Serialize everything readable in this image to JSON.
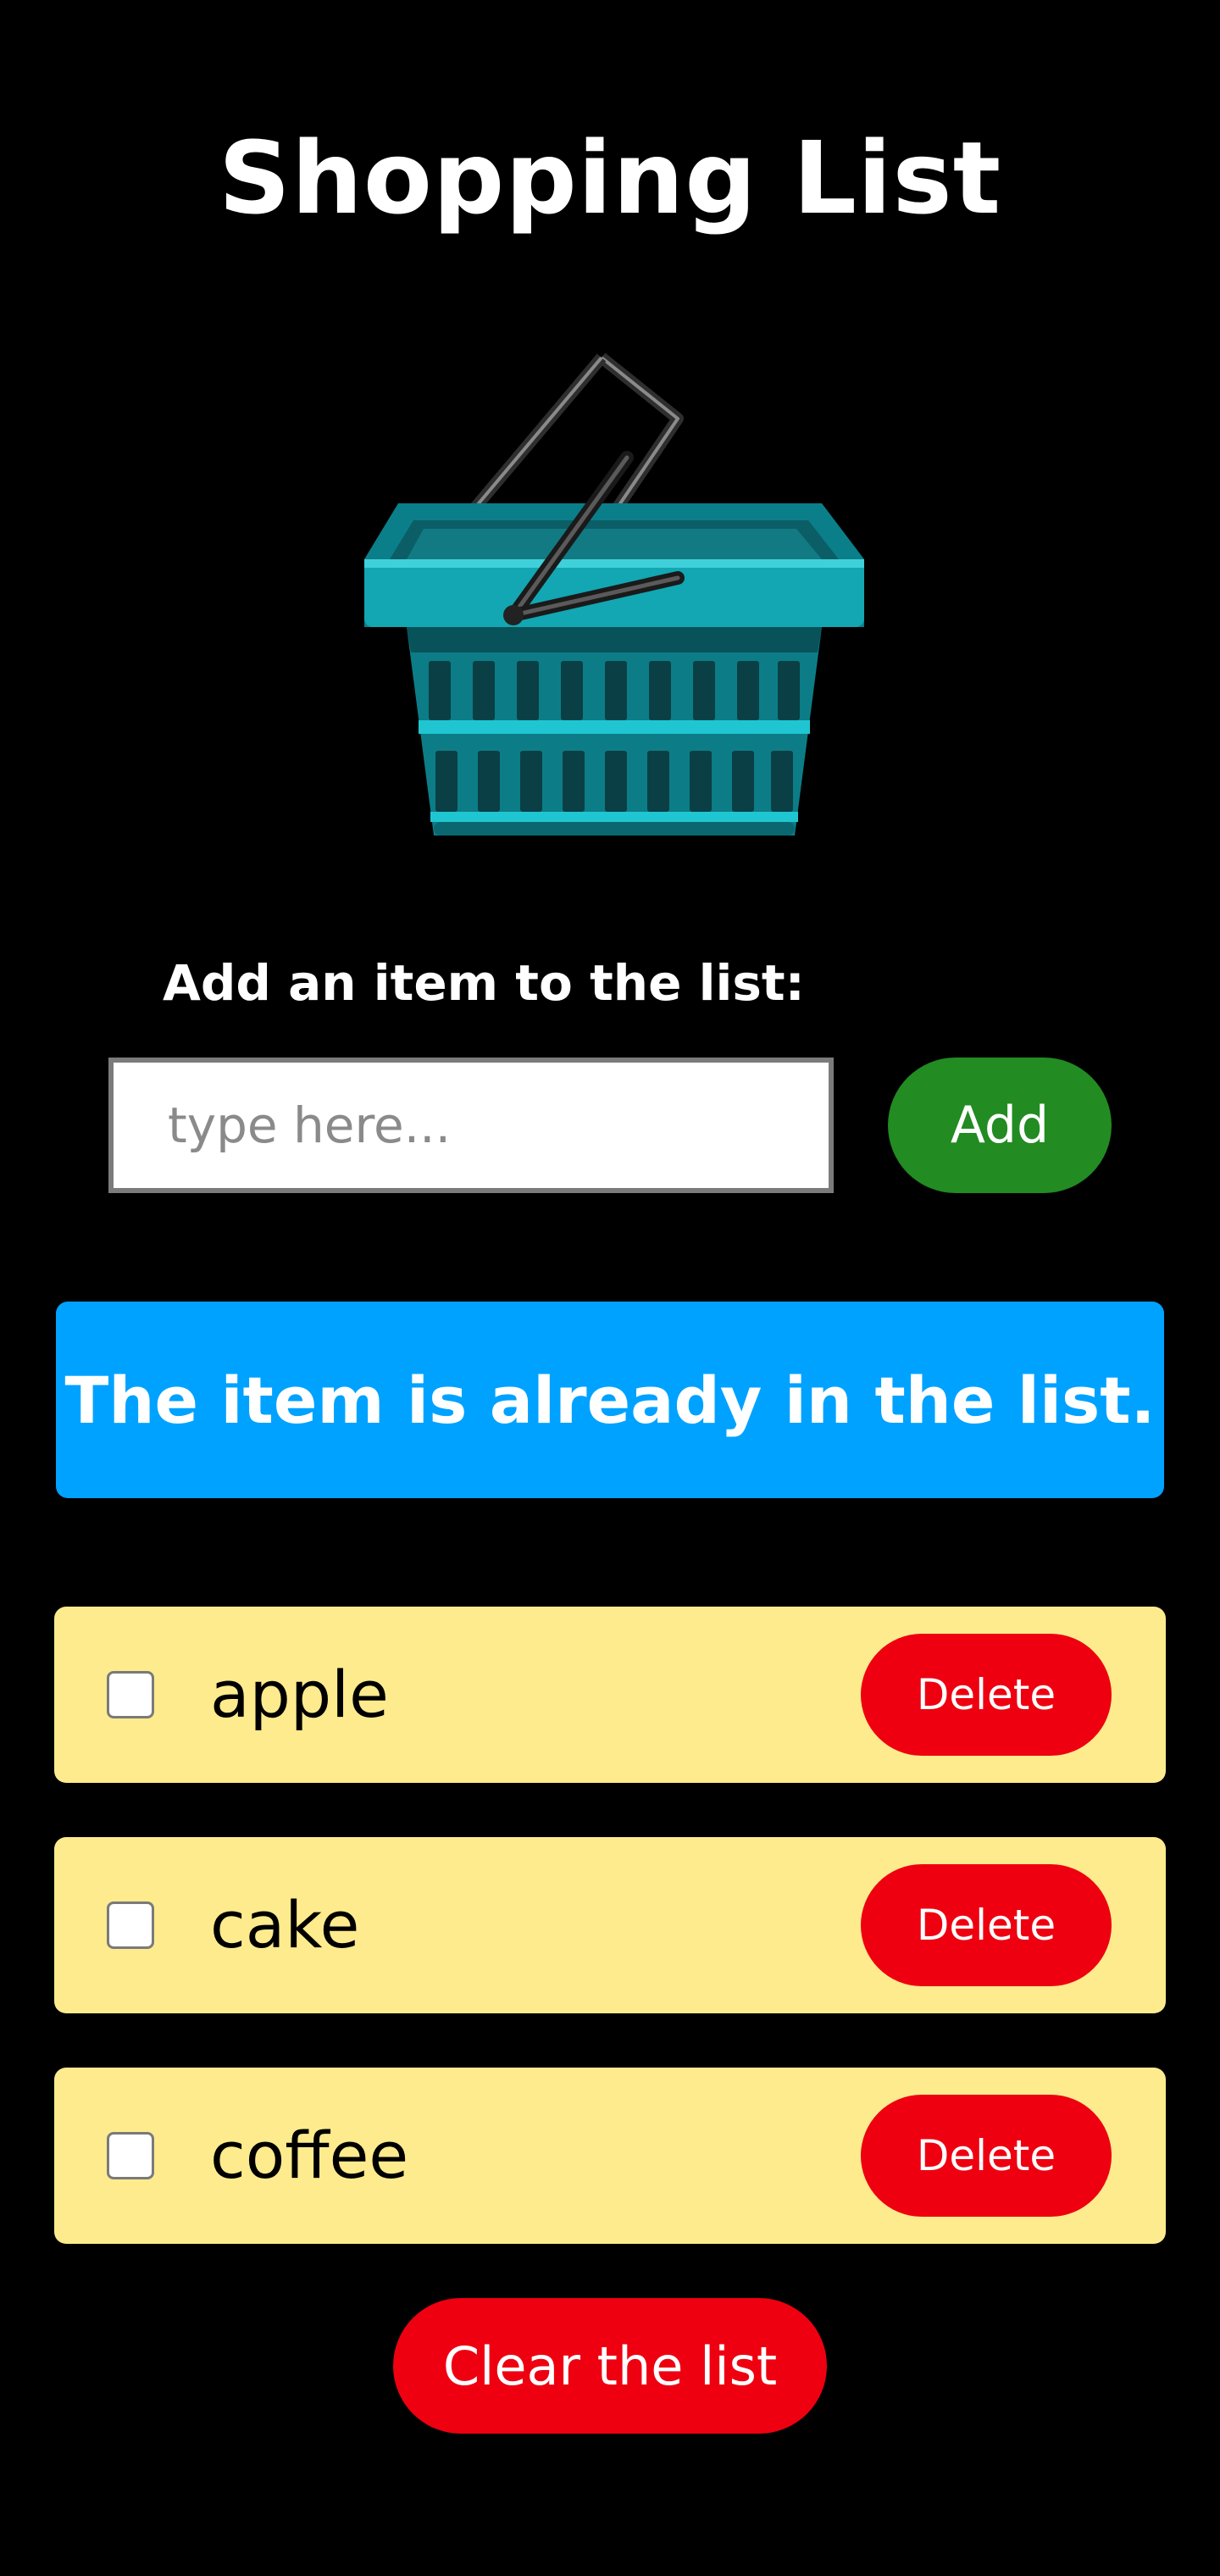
{
  "header": {
    "title": "Shopping List"
  },
  "illustration": {
    "icon": "shopping-basket-icon",
    "colors": {
      "basket": "#0e8b95",
      "basket_dark": "#08525a",
      "slot": "#1fc6d2",
      "handle": "#3a3a3a"
    }
  },
  "form": {
    "label": "Add an item to the list:",
    "input_placeholder": "type here...",
    "input_value": "",
    "add_label": "Add"
  },
  "message": {
    "text": "The item is already in the list.",
    "color": "#00a2ff"
  },
  "items": [
    {
      "text": "apple",
      "checked": false,
      "delete_label": "Delete"
    },
    {
      "text": "cake",
      "checked": false,
      "delete_label": "Delete"
    },
    {
      "text": "coffee",
      "checked": false,
      "delete_label": "Delete"
    }
  ],
  "footer": {
    "clear_label": "Clear the list"
  },
  "colors": {
    "background": "#000000",
    "add_button": "#228b22",
    "delete_button": "#ee0010",
    "item_background": "#fdeb8d"
  }
}
